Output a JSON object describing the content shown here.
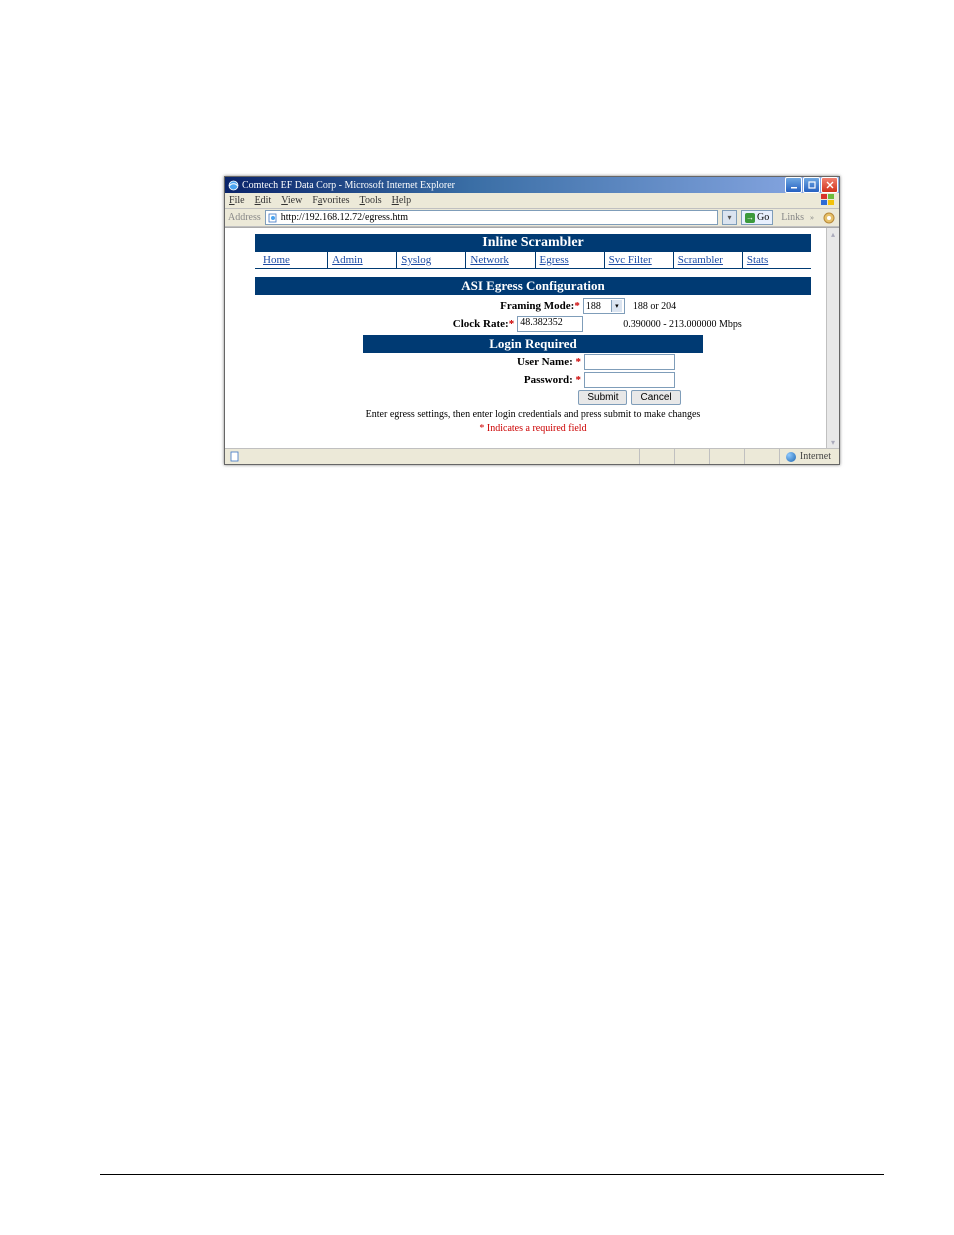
{
  "window": {
    "title": "Comtech EF Data Corp - Microsoft Internet Explorer"
  },
  "menubar": {
    "items": [
      "File",
      "Edit",
      "View",
      "Favorites",
      "Tools",
      "Help"
    ]
  },
  "addressbar": {
    "label": "Address",
    "url": "http://192.168.12.72/egress.htm",
    "go": "Go",
    "links": "Links"
  },
  "page": {
    "header": "Inline Scrambler",
    "nav": [
      "Home",
      "Admin",
      "Syslog",
      "Network",
      "Egress",
      "Svc Filter",
      "Scrambler",
      "Stats"
    ],
    "section1": "ASI Egress Configuration",
    "framing": {
      "label": "Framing Mode:",
      "value": "188",
      "hint": "188 or 204"
    },
    "clock": {
      "label": "Clock Rate:",
      "value": "48.382352",
      "hint": "0.390000 - 213.000000 Mbps"
    },
    "login": {
      "band": "Login Required",
      "user_label": "User Name:",
      "pass_label": "Password:",
      "submit": "Submit",
      "cancel": "Cancel"
    },
    "note1": "Enter egress settings, then enter login credentials and press submit to make changes",
    "note2": "* Indicates a required field"
  },
  "status": {
    "zone": "Internet"
  }
}
